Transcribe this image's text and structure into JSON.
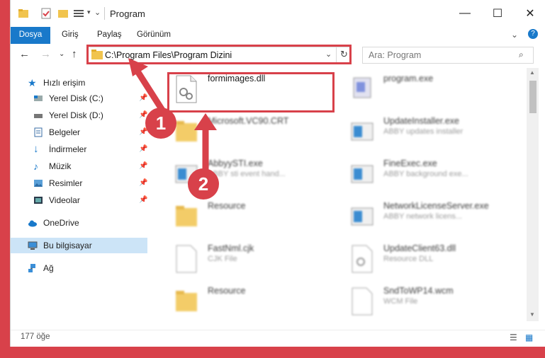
{
  "window": {
    "title": "Program"
  },
  "ribbon": {
    "tabs": [
      "Dosya",
      "Giriş",
      "Paylaş",
      "Görünüm"
    ]
  },
  "address": {
    "path": "C:\\Program Files\\Program Dizini"
  },
  "search": {
    "placeholder": "Ara: Program"
  },
  "sidebar": {
    "items": [
      {
        "label": "Hızlı erişim",
        "icon": "star-icon"
      },
      {
        "label": "Yerel Disk (C:)",
        "icon": "drive-icon"
      },
      {
        "label": "Yerel Disk (D:)",
        "icon": "drive-icon"
      },
      {
        "label": "Belgeler",
        "icon": "documents-icon"
      },
      {
        "label": "İndirmeler",
        "icon": "download-icon"
      },
      {
        "label": "Müzik",
        "icon": "music-icon"
      },
      {
        "label": "Resimler",
        "icon": "pictures-icon"
      },
      {
        "label": "Videolar",
        "icon": "videos-icon"
      },
      {
        "label": "OneDrive",
        "icon": "cloud-icon"
      },
      {
        "label": "Bu bilgisayar",
        "icon": "computer-icon"
      },
      {
        "label": "Ağ",
        "icon": "network-icon"
      }
    ]
  },
  "files": [
    {
      "name": "formimages.dll",
      "sub": "",
      "kind": "dll"
    },
    {
      "name": "program.exe",
      "sub": "",
      "kind": "exe"
    },
    {
      "name": "Microsoft.VC90.CRT",
      "sub": "",
      "kind": "folder"
    },
    {
      "name": "UpdateInstaller.exe",
      "sub": "ABBY updates installer",
      "kind": "exe"
    },
    {
      "name": "AbbyySTI.exe",
      "sub": "ABBY sti event hand...",
      "kind": "exe"
    },
    {
      "name": "FineExec.exe",
      "sub": "ABBY background exe...",
      "kind": "exe"
    },
    {
      "name": "Resource",
      "sub": "",
      "kind": "folder"
    },
    {
      "name": "NetworkLicenseServer.exe",
      "sub": "ABBY network licens...",
      "kind": "exe"
    },
    {
      "name": "FastNml.cjk",
      "sub": "CJK File",
      "kind": "file"
    },
    {
      "name": "UpdateClient63.dll",
      "sub": "Resource DLL",
      "kind": "dll"
    },
    {
      "name": "Resource",
      "sub": "",
      "kind": "folder"
    },
    {
      "name": "SndToWP14.wcm",
      "sub": "WCM File",
      "kind": "file"
    }
  ],
  "status": {
    "count": "177 öğe"
  },
  "annotations": [
    "1",
    "2"
  ],
  "colors": {
    "accent": "#1979ca",
    "annotation": "#d8414a"
  }
}
